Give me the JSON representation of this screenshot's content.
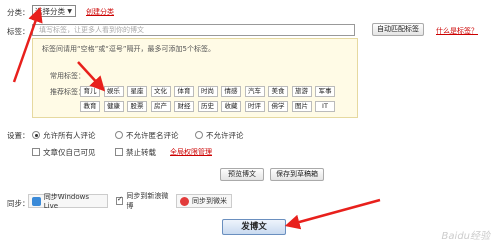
{
  "category": {
    "label": "分类：",
    "selected": "选择分类",
    "create_link": "创建分类"
  },
  "tags": {
    "label": "标签：",
    "placeholder": "填写标签，让更多人看到你的博文",
    "auto_match_button": "自动匹配标签",
    "what_is_link": "什么是标签？",
    "tip": "标签间请用“空格”或“逗号”隔开，最多可添加5个标签。",
    "common_label": "常用标签：",
    "recommended_label": "推荐标签：",
    "row1": [
      "育儿",
      "娱乐",
      "星座",
      "文化",
      "体育",
      "时尚",
      "情感",
      "汽车",
      "美食",
      "旅游",
      "军事"
    ],
    "row2": [
      "教育",
      "健康",
      "股票",
      "房产",
      "财经",
      "历史",
      "收藏",
      "时评",
      "佛学",
      "图片",
      "IT"
    ]
  },
  "settings": {
    "label": "设置：",
    "comment_options": [
      "允许所有人评论",
      "不允许匿名评论",
      "不允许评论"
    ],
    "selected_comment": "允许所有人评论",
    "private_label": "文章仅自己可见",
    "no_repost_label": "禁止转载",
    "permission_link": "全局权限管理"
  },
  "actions": {
    "preview_button": "预览博文",
    "save_draft_button": "保存到草稿箱"
  },
  "sync": {
    "label": "同步：",
    "items": [
      "同步Windows Live",
      "同步到新浪微博",
      "同步到微米"
    ]
  },
  "publish_button": "发博文",
  "watermark": "Baidu经验",
  "colors": {
    "arrow": "#e8201c",
    "link": "#cc0000",
    "tip_bg": "#fffbe6"
  }
}
